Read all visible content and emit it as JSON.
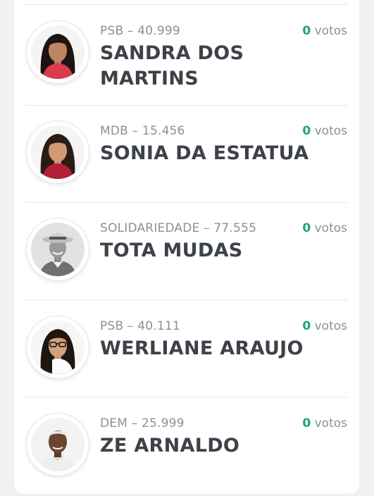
{
  "candidates": [
    {
      "party_number": "PSB – 40.999",
      "name": "SANDRA DOS MARTINS",
      "votes_count": "0",
      "votes_label": "votos",
      "photo_icon": "candidate-photo-woman-dark-hair"
    },
    {
      "party_number": "MDB – 15.456",
      "name": "SONIA DA ESTATUA",
      "votes_count": "0",
      "votes_label": "votos",
      "photo_icon": "candidate-photo-woman-dark-hair"
    },
    {
      "party_number": "SOLIDARIEDADE – 77.555",
      "name": "TOTA MUDAS",
      "votes_count": "0",
      "votes_label": "votos",
      "photo_icon": "candidate-photo-man-hat-grayscale"
    },
    {
      "party_number": "PSB – 40.111",
      "name": "WERLIANE ARAUJO",
      "votes_count": "0",
      "votes_label": "votos",
      "photo_icon": "candidate-photo-woman-glasses"
    },
    {
      "party_number": "DEM – 25.999",
      "name": "ZE ARNALDO",
      "votes_count": "0",
      "votes_label": "votos",
      "photo_icon": "candidate-photo-man-white-hair"
    }
  ],
  "colors": {
    "votes_count": "#19a86b",
    "meta_text": "#8a9099",
    "name_text": "#3d4148",
    "divider": "#e6e8eb",
    "page_bg": "#f0f1f3"
  }
}
